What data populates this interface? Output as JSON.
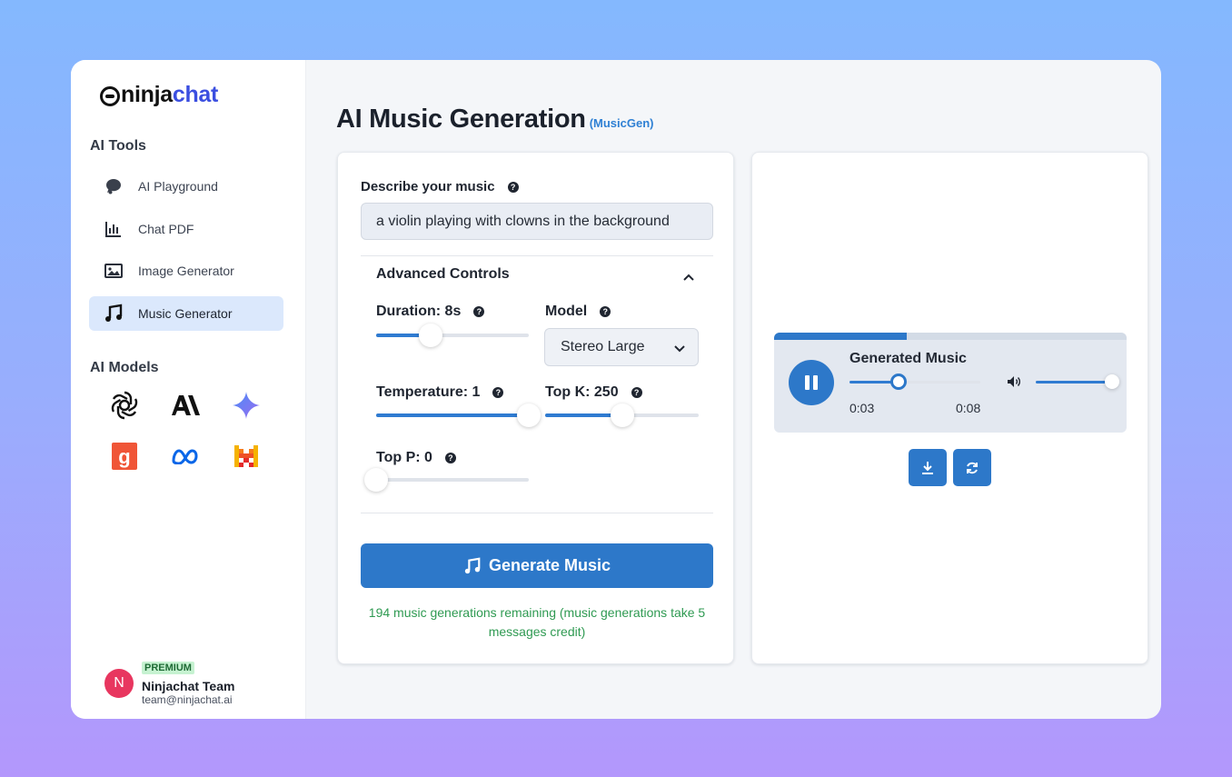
{
  "brand": {
    "name_part1": "ninja",
    "name_part2": "chat",
    "accent": "#3b4fe0"
  },
  "sidebar": {
    "tools_heading": "AI Tools",
    "items": [
      {
        "label": "AI Playground",
        "icon": "chat-bubble-icon",
        "active": false
      },
      {
        "label": "Chat PDF",
        "icon": "bar-chart-icon",
        "active": false
      },
      {
        "label": "Image Generator",
        "icon": "image-icon",
        "active": false
      },
      {
        "label": "Music Generator",
        "icon": "music-note-icon",
        "active": true
      }
    ],
    "models_heading": "AI Models",
    "models": [
      "openai-icon",
      "anthropic-icon",
      "gemini-icon",
      "groq-icon",
      "meta-icon",
      "mistral-icon"
    ]
  },
  "user": {
    "initial": "N",
    "badge": "PREMIUM",
    "name": "Ninjachat Team",
    "email": "team@ninjachat.ai"
  },
  "page": {
    "title": "AI Music Generation",
    "subtitle": "(MusicGen)"
  },
  "form": {
    "prompt_label": "Describe your music",
    "prompt_value": "a violin playing with clowns in the background",
    "advanced_label": "Advanced Controls",
    "duration": {
      "label": "Duration: 8s",
      "fraction": 0.36
    },
    "model": {
      "label": "Model",
      "selected": "Stereo Large"
    },
    "temperature": {
      "label": "Temperature: 1",
      "fraction": 1.0
    },
    "top_k": {
      "label": "Top K: 250",
      "fraction": 0.5
    },
    "top_p": {
      "label": "Top P: 0",
      "fraction": 0.0
    },
    "generate_label": "Generate Music",
    "credit_text": "194 music generations remaining (music generations take 5 messages credit)"
  },
  "player": {
    "title": "Generated Music",
    "current_time": "0:03",
    "duration": "0:08",
    "progress_fraction": 0.375,
    "volume_fraction": 1.0
  },
  "colors": {
    "primary": "#2d78c9",
    "success": "#2f9a52",
    "premium_bg": "#c6f2d1"
  }
}
